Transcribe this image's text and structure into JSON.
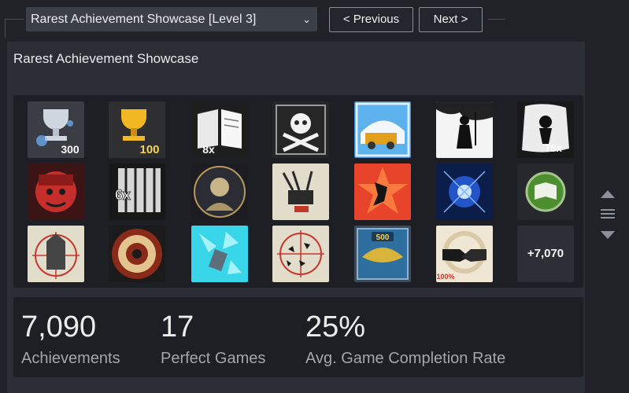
{
  "showcase_select": {
    "value": "Rarest Achievement Showcase [Level 3]",
    "icon": "chevron-down-icon"
  },
  "nav": {
    "previous": "< Previous",
    "next": "Next >"
  },
  "panel": {
    "title": "Rarest Achievement Showcase"
  },
  "achievements": [
    {
      "icon": "silver-trophy-300-icon",
      "overlay": "300"
    },
    {
      "icon": "gold-trophy-100-icon",
      "overlay": "100"
    },
    {
      "icon": "open-book-8x-icon",
      "overlay": "8x"
    },
    {
      "icon": "skull-crossbones-icon"
    },
    {
      "icon": "snow-truck-icon"
    },
    {
      "icon": "archer-silhouette-icon"
    },
    {
      "icon": "figure-75x-icon",
      "overlay": "75x"
    },
    {
      "icon": "masked-face-icon"
    },
    {
      "icon": "prison-bars-6x-icon",
      "overlay": "6x"
    },
    {
      "icon": "bust-medallion-icon"
    },
    {
      "icon": "anti-air-gun-icon"
    },
    {
      "icon": "explosion-figure-icon"
    },
    {
      "icon": "blue-energy-icon"
    },
    {
      "icon": "green-book-badge-icon"
    },
    {
      "icon": "tower-target-icon"
    },
    {
      "icon": "wheel-target-icon"
    },
    {
      "icon": "shattered-blue-icon"
    },
    {
      "icon": "crosshair-target-icon"
    },
    {
      "icon": "wings-500-badge-icon",
      "overlay": "500"
    },
    {
      "icon": "handshake-100-icon",
      "overlay": "100%"
    }
  ],
  "more_count": "+7,070",
  "stats": [
    {
      "value": "7,090",
      "label": "Achievements"
    },
    {
      "value": "17",
      "label": "Perfect Games"
    },
    {
      "value": "25%",
      "label": "Avg. Game Completion Rate"
    }
  ],
  "colors": {
    "panel": "#2b2e35",
    "inner": "#1d1f24",
    "label": "#a3a6ab",
    "select": "#3b3f47"
  }
}
